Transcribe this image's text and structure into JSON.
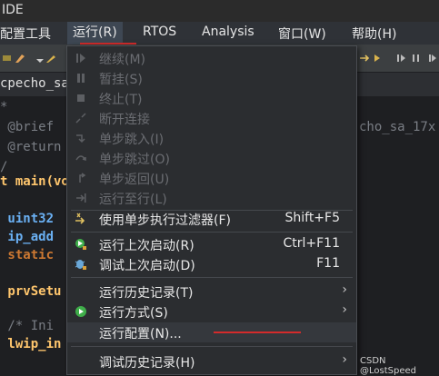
{
  "window": {
    "title": "IDE"
  },
  "menubar": {
    "items": [
      {
        "label": "配置工具"
      },
      {
        "label": "运行(R)"
      },
      {
        "label": "RTOS"
      },
      {
        "label": "Analysis"
      },
      {
        "label": "窗口(W)"
      },
      {
        "label": "帮助(H)"
      }
    ]
  },
  "editor": {
    "tab_label": "cpecho_sa",
    "lines": [
      "*",
      " @brief",
      " @return",
      "/",
      "t main(vo",
      "",
      " uint32",
      " ip_add",
      " static",
      "",
      " prvSetu",
      "",
      " /* Ini",
      " lwip_in"
    ],
    "hidden_fragment": "cho_sa_17x"
  },
  "run_menu": {
    "items": [
      {
        "label": "继续(M)",
        "enabled": false,
        "icon": "resume-icon"
      },
      {
        "label": "暂挂(S)",
        "enabled": false,
        "icon": "suspend-icon"
      },
      {
        "label": "终止(T)",
        "enabled": false,
        "icon": "terminate-icon"
      },
      {
        "label": "断开连接",
        "enabled": false,
        "icon": "disconnect-icon"
      },
      {
        "label": "单步跳入(I)",
        "enabled": false,
        "icon": "step-into-icon"
      },
      {
        "label": "单步跳过(O)",
        "enabled": false,
        "icon": "step-over-icon"
      },
      {
        "label": "单步返回(U)",
        "enabled": false,
        "icon": "step-return-icon"
      },
      {
        "label": "运行至行(L)",
        "enabled": false,
        "icon": "run-to-line-icon"
      },
      {
        "label": "使用单步执行过滤器(F)",
        "shortcut": "Shift+F5",
        "enabled": true,
        "icon": "step-filter-icon"
      },
      {
        "label": "运行上次启动(R)",
        "shortcut": "Ctrl+F11",
        "enabled": true,
        "icon": "run-last-icon"
      },
      {
        "label": "调试上次启动(D)",
        "shortcut": "F11",
        "enabled": true,
        "icon": "debug-last-icon"
      },
      {
        "label": "运行历史记录(T)",
        "submenu": true,
        "enabled": true
      },
      {
        "label": "运行方式(S)",
        "submenu": true,
        "enabled": true,
        "icon": "run-as-icon"
      },
      {
        "label": "运行配置(N)...",
        "enabled": true
      },
      {
        "label": "调试历史记录(H)",
        "submenu": true,
        "enabled": true
      }
    ]
  },
  "watermark": "CSDN @LostSpeed",
  "colors": {
    "menu_bg": "#2b2d30",
    "highlight_red": "#d32b2b",
    "disabled_text": "#6b6d72"
  }
}
